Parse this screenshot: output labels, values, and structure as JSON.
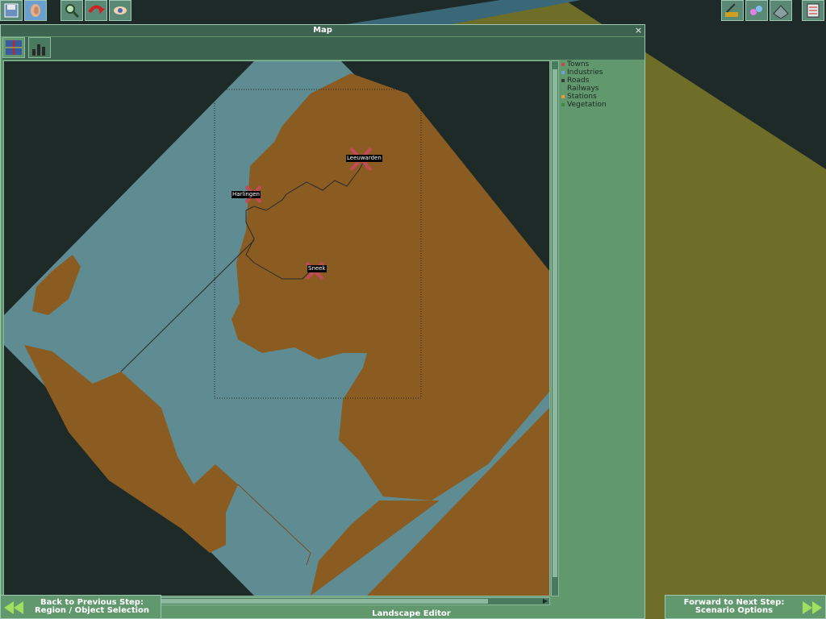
{
  "window": {
    "title": "Map",
    "close_label": "×"
  },
  "toolbar": {
    "left": [
      "disk-icon",
      "ear-icon",
      "magnifier-icon",
      "rotate-icon",
      "eye-icon"
    ],
    "right": [
      "construction-icon",
      "landscape-icon",
      "terrain-icon",
      "list-icon"
    ]
  },
  "tabs": [
    {
      "icon": "map-overview-icon",
      "active": true
    },
    {
      "icon": "industry-chart-icon",
      "active": false
    }
  ],
  "legend": [
    {
      "label": "Towns",
      "color": "#c44a5a"
    },
    {
      "label": "Industries",
      "color": "#6fa4d4"
    },
    {
      "label": "Roads",
      "color": "#3a3a3a"
    },
    {
      "label": "Railways",
      "color": ""
    },
    {
      "label": "Stations",
      "color": "#e0a040"
    },
    {
      "label": "Vegetation",
      "color": "#3e8a3e"
    }
  ],
  "towns": [
    {
      "name": "Leeuwarden"
    },
    {
      "name": "Harlingen"
    },
    {
      "name": "Sneek"
    }
  ],
  "colors": {
    "water": "#5f8c92",
    "land": "#8a5c22",
    "void": "#1d2a28",
    "panel": "#62986e"
  },
  "bottom": {
    "back": {
      "line1": "Back to Previous Step:",
      "line2": "Region / Object Selection"
    },
    "forward": {
      "line1": "Forward to Next Step:",
      "line2": "Scenario Options"
    },
    "status": "Landscape Editor"
  }
}
